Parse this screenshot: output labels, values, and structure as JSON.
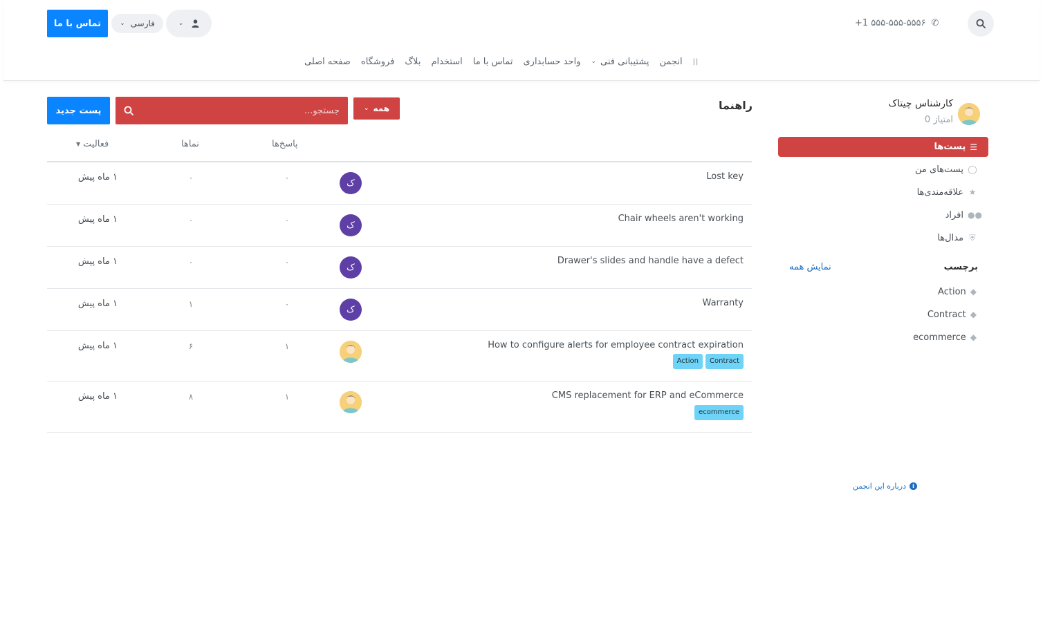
{
  "header": {
    "phone": "+1 ۵۵۵-۵۵۵-۵۵۵۶",
    "contact_button": "تماس با ما",
    "language": "فارسی",
    "nav": [
      "صفحه اصلی",
      "فروشگاه",
      "بلاگ",
      "استخدام",
      "تماس با ما",
      "واحد حسابداری",
      "پشتیبانی فنی",
      "انجمن"
    ]
  },
  "sidebar": {
    "user_name": "کارشناس چیتاک",
    "user_points": "0 امتیاز",
    "active_item": "پست‌ها",
    "items": [
      "پست‌های من",
      "علاقه‌مندی‌ها",
      "افراد",
      "مدال‌ها"
    ],
    "tags_title": "برچسب",
    "show_all": "نمایش همه",
    "tags": [
      "Action",
      "Contract",
      "ecommerce"
    ],
    "about": "درباره این انجمن"
  },
  "main": {
    "title": "راهنما",
    "filter_label": "همه",
    "search_placeholder": "جستجو...",
    "new_post": "پست جدید",
    "columns": {
      "replies": "پاسخ‌ها",
      "views": "نماها",
      "activity": "فعالیت"
    },
    "rows": [
      {
        "title": "Lost key",
        "avatar": "ک",
        "replies": "۰",
        "views": "۰",
        "time": "۱ ماه پیش",
        "tags": []
      },
      {
        "title": "Chair wheels aren't working",
        "avatar": "ک",
        "replies": "۰",
        "views": "۰",
        "time": "۱ ماه پیش",
        "tags": []
      },
      {
        "title": "Drawer's slides and handle have a defect",
        "avatar": "ک",
        "replies": "۰",
        "views": "۰",
        "time": "۱ ماه پیش",
        "tags": []
      },
      {
        "title": "Warranty",
        "avatar": "ک",
        "replies": "۰",
        "views": "۱",
        "time": "۱ ماه پیش",
        "tags": []
      },
      {
        "title": "How to configure alerts for employee contract expiration",
        "avatar": "",
        "replies": "۱",
        "views": "۶",
        "time": "۱ ماه پیش",
        "tags": [
          "Contract",
          "Action"
        ]
      },
      {
        "title": "CMS replacement for ERP and eCommerce",
        "avatar": "",
        "replies": "۱",
        "views": "۸",
        "time": "۱ ماه پیش",
        "tags": [
          "ecommerce"
        ]
      }
    ]
  },
  "colors": {
    "primary": "#0a84ff",
    "danger": "#d04343",
    "avatar_purple": "#5e3fa6",
    "tag_chip": "#6fd3f7"
  }
}
